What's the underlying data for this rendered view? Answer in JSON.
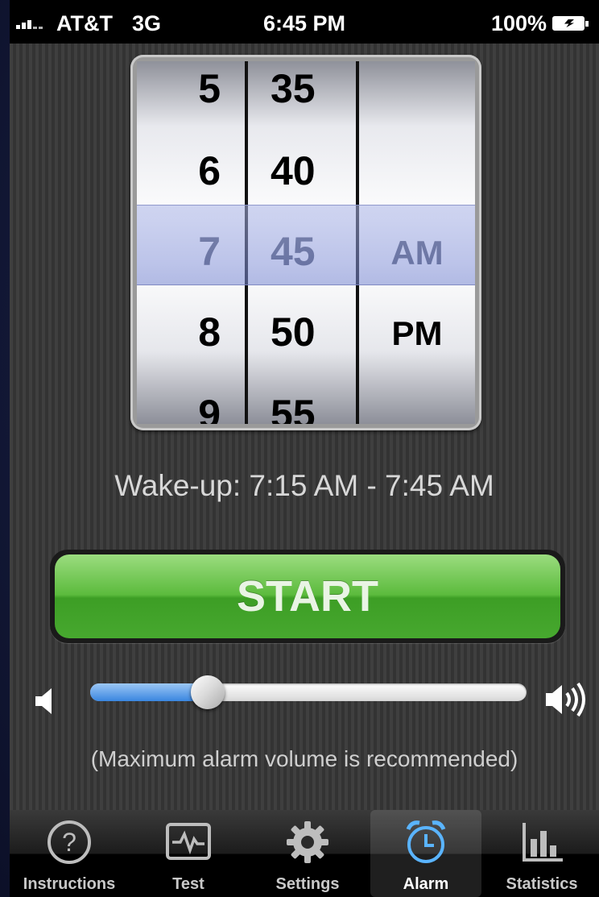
{
  "status_bar": {
    "carrier": "AT&T",
    "network": "3G",
    "time": "6:45 PM",
    "battery": "100%"
  },
  "picker": {
    "hours": [
      "5",
      "6",
      "7",
      "8",
      "9"
    ],
    "minutes": [
      "35",
      "40",
      "45",
      "50",
      "55"
    ],
    "ampm": [
      "AM",
      "PM"
    ],
    "selected": {
      "hour": "7",
      "minute": "45",
      "ampm": "AM"
    }
  },
  "wakeup_text": "Wake-up: 7:15 AM - 7:45 AM",
  "start_label": "START",
  "volume": {
    "level": 0.27
  },
  "volume_note": "(Maximum alarm volume is recommended)",
  "tabs": [
    {
      "label": "Instructions",
      "icon": "question-circle-icon"
    },
    {
      "label": "Test",
      "icon": "heartbeat-icon"
    },
    {
      "label": "Settings",
      "icon": "gear-icon"
    },
    {
      "label": "Alarm",
      "icon": "alarm-clock-icon",
      "active": true
    },
    {
      "label": "Statistics",
      "icon": "bar-chart-icon"
    }
  ],
  "colors": {
    "start_green": "#4fae33",
    "slider_blue": "#3a86e0",
    "tab_active_icon": "#5ab4ff"
  }
}
